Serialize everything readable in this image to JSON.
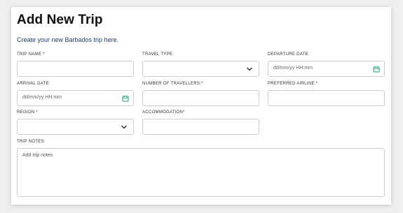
{
  "header": {
    "title": "Add New Trip",
    "subtitle": "Create your new Barbados trip here."
  },
  "form": {
    "trip_name": {
      "label": "TRIP NAME:*",
      "value": ""
    },
    "travel_type": {
      "label": "TRAVEL TYPE:",
      "selected": ""
    },
    "departure_date": {
      "label": "DEPARTURE DATE:",
      "placeholder": "dd/mm/yy HH:mm"
    },
    "arrival_date": {
      "label": "ARRIVAL DATE:",
      "placeholder": "dd/mm/yy HH:mm"
    },
    "number_of_travellers": {
      "label": "NUMBER OF TRAVELLERS:*",
      "value": ""
    },
    "preferred_airline": {
      "label": "PREFERRED AIRLINE:*",
      "value": ""
    },
    "region": {
      "label": "REGION *",
      "selected": ""
    },
    "accommodation": {
      "label": "ACCOMMODATION*",
      "value": ""
    },
    "trip_notes": {
      "label": "TRIP NOTES:",
      "placeholder": "Add trip notes"
    }
  },
  "colors": {
    "calendar_icon": "#1a9e8a",
    "subtitle": "#1f3a6b",
    "border": "#c9ced6"
  },
  "icons": {
    "dropdown": "chevron-down-icon",
    "date": "calendar-icon"
  }
}
